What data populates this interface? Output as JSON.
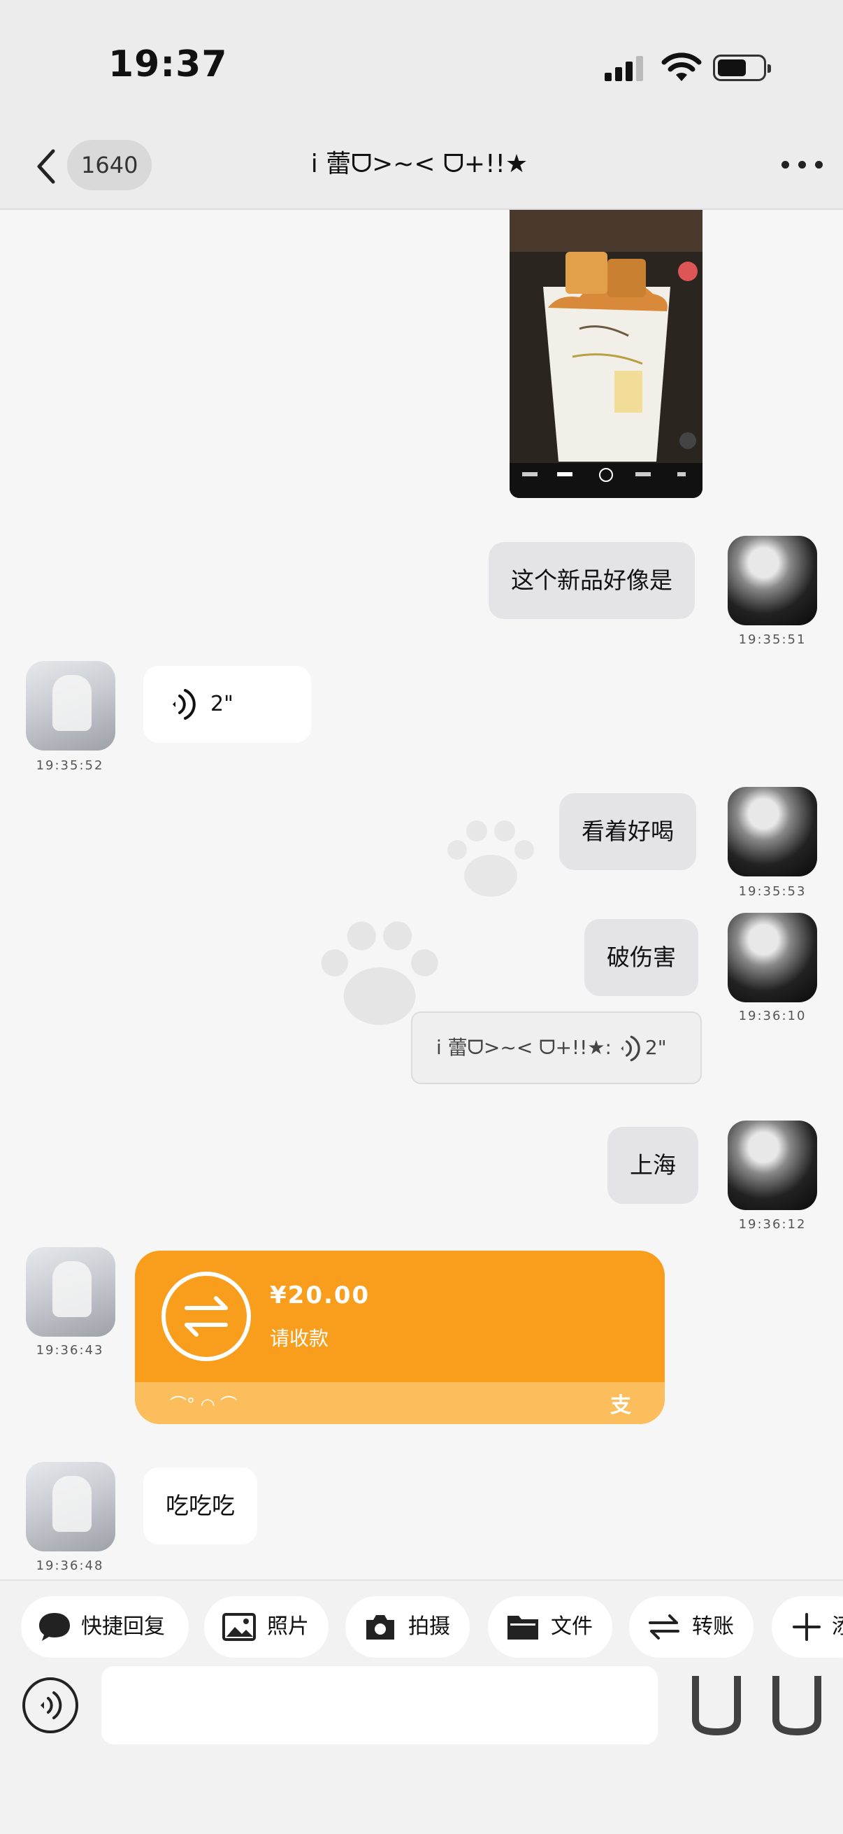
{
  "status_bar": {
    "time": "19:37"
  },
  "nav": {
    "back_label": "",
    "unread_count": "1640",
    "title": "i 蕾ᗜ>~< ᗜ+!!★"
  },
  "messages": [
    {
      "id": "photo",
      "sender": "me",
      "type": "image"
    },
    {
      "id": "m1",
      "sender": "me",
      "type": "text",
      "text": "这个新品好像是",
      "time": "19:35:51"
    },
    {
      "id": "m2",
      "sender": "other",
      "type": "voice",
      "duration": "2\"",
      "time": "19:35:52"
    },
    {
      "id": "m3",
      "sender": "me",
      "type": "text",
      "text": "看着好喝",
      "time": "19:35:53"
    },
    {
      "id": "m4",
      "sender": "me",
      "type": "text",
      "text": "破伤害",
      "time": "19:36:10",
      "quote": {
        "name": "i 蕾ᗜ>~< ᗜ+!!★:",
        "duration": "2\""
      }
    },
    {
      "id": "m5",
      "sender": "me",
      "type": "text",
      "text": "上海",
      "time": "19:36:12"
    },
    {
      "id": "m6",
      "sender": "other",
      "type": "transfer",
      "amount": "¥20.00",
      "status": "请收款",
      "emote": "⌒° ◠ ⌒",
      "brand": "支",
      "time": "19:36:43"
    },
    {
      "id": "m7",
      "sender": "other",
      "type": "text",
      "text": "吃吃吃",
      "time": "19:36:48"
    }
  ],
  "toolbar": {
    "chips": [
      {
        "label": "快捷回复",
        "icon": "speech-bubble-icon"
      },
      {
        "label": "照片",
        "icon": "image-icon"
      },
      {
        "label": "拍摄",
        "icon": "camera-icon"
      },
      {
        "label": "文件",
        "icon": "folder-icon"
      },
      {
        "label": "转账",
        "icon": "transfer-icon"
      },
      {
        "label": "添",
        "icon": "plus-icon"
      }
    ],
    "input_placeholder": ""
  },
  "colors": {
    "transfer_orange": "#f99e1c",
    "transfer_footer": "#fcbd5c",
    "bubble_me": "#e4e4e6",
    "bubble_other": "#ffffff"
  }
}
